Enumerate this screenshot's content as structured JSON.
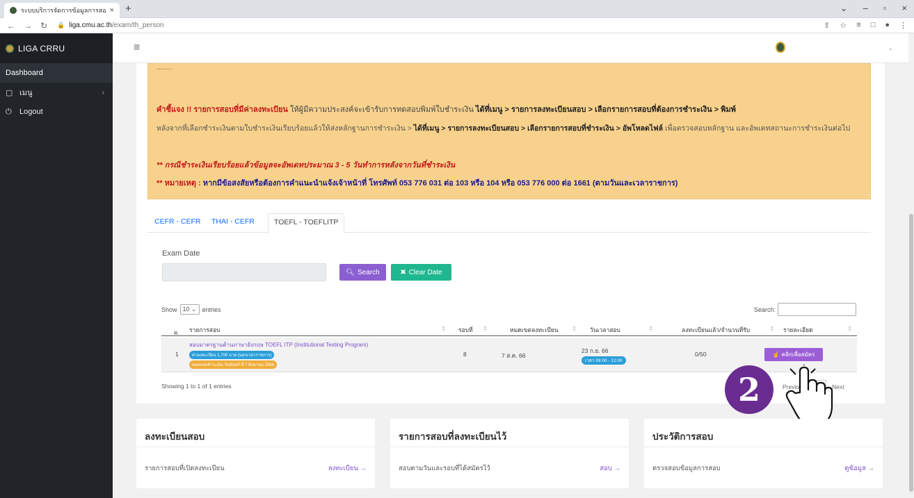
{
  "browser": {
    "tab_title": "ระบบบริการจัดการข้อมูลการสอบ - LIG",
    "new_tab": "+",
    "url_host": "liga.cmu.ac.th",
    "url_path": "/exam/th_person"
  },
  "sidebar": {
    "brand": "LIGA CRRU",
    "items": [
      {
        "label": "Dashboard"
      },
      {
        "label": "เมนู"
      },
      {
        "label": "Logout"
      }
    ]
  },
  "notice": {
    "cut_line": "........",
    "line1_prefix": "คำชี้แจง !!",
    "line1_red": "รายการสอบที่มีค่าลงทะเบียน",
    "line1_text": "ให้ผู้มีความประสงค์จะเข้ารับการทดสอบพิมพ์ใบชำระเงิน",
    "line1_path": "ได้ที่เมนู > รายการลงทะเบียนสอบ > เลือกรายการสอบที่ต้องการชำระเงิน > พิมพ์",
    "line2_text": "หลังจากที่เลือกชำระเงินตามใบชำระเงินเรียบร้อยแล้วให้ส่งหลักฐานการชำระเงิน >",
    "line2_path": "ได้ที่เมนู > รายการลงทะเบียนสอบ > เลือกรายการสอบที่ชำระเงิน > อัพโหลดไฟล์",
    "line2_tail": "เพื่อตรวจสอบหลักฐาน และอัพเดทสถานะการชำระเงินต่อไป",
    "line3": "** กรณีชำระเงินเรียบร้อยแล้วข้อมูลจะอัพเดทประมาณ 3 - 5 วันทำการหลังจากวันที่ชำระเงิน",
    "line4_prefix": "** หมายเหตุ :",
    "line4_text": "หากมีข้อสงสัยหรือต้องการคำแนะนำแจ้งเจ้าหน้าที่ โทรศัพท์ 053 776 031 ต่อ 103 หรือ 104 หรือ 053 776 000 ต่อ 1661 (ตามวันและเวลาราชการ)"
  },
  "tabs": [
    {
      "label": "CEFR - CEFR"
    },
    {
      "label": "THAI - CEFR"
    },
    {
      "label": "TOEFL - TOEFLITP"
    }
  ],
  "form": {
    "exam_date_label": "Exam Date",
    "search_btn": "Search",
    "clear_btn": "Clear Date"
  },
  "table": {
    "show_label": "Show",
    "entries_value": "10",
    "entries_label": "entries",
    "search_label": "Search:",
    "headers": [
      "#",
      "รายการสอบ",
      "รอบที่",
      "หมดเขตลงทะเบียน",
      "วันเวลาสอบ",
      "ลงทะเบียนแล้ว/จำนวนที่รับ",
      "รายละเอียด"
    ],
    "rows": [
      {
        "no": "1",
        "title": "สอบมาตรฐานด้านภาษาอังกฤษ TOEFL ITP (Institutional Testing Program)",
        "fee_badge": "ค่าลงทะเบียน 1,700 บาท (นอกเวลาราชการ)",
        "deadline_badge": "หมดเขตชำระเงิน วันจันทร์ ที่ 7 สิงหาคม 2566",
        "round": "8",
        "deadline": "7 ส.ค. 66",
        "exam_date": "23 ก.ย. 66",
        "exam_time": "เวลา 09:00 - 12:00",
        "registered": "0/50",
        "apply_btn": "คลิกเพื่อสมัคร"
      }
    ],
    "showing": "Showing 1 to 1 of 1 entries",
    "prev": "Previous",
    "next": "Next"
  },
  "step_number": "2",
  "bottom_cards": [
    {
      "title": "ลงทะเบียนสอบ",
      "text": "รายการสอบที่เปิดลงทะเบียน",
      "link": "ลงทะเบียน →"
    },
    {
      "title": "รายการสอบที่ลงทะเบียนไว้",
      "text": "สอบตามวันและรอบที่ได้สมัครไว้",
      "link": "สอบ →"
    },
    {
      "title": "ประวัติการสอบ",
      "text": "ตรวจสอบข้อมูลการสอบ",
      "link": "ดูข้อมูล →"
    }
  ],
  "colors": {
    "sidebar": "#212529",
    "notice_bg": "#f8d28c",
    "search_btn": "#8b5fd1",
    "clear_btn": "#1fb78f",
    "apply_btn": "#9c5ed6",
    "step_badge": "#6a2c91"
  }
}
